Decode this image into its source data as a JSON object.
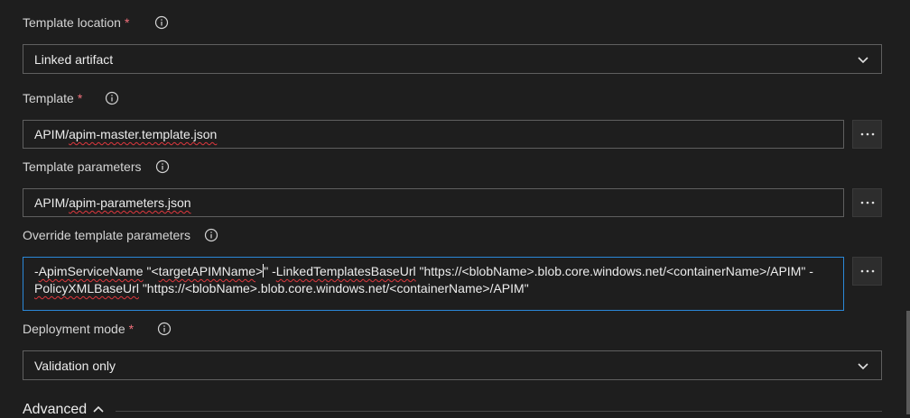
{
  "template_location": {
    "label": "Template location",
    "required": "*",
    "info_icon": "info-circle-icon",
    "value": "Linked artifact",
    "chevron_icon": "chevron-down-icon"
  },
  "template": {
    "label": "Template",
    "required": "*",
    "info_icon": "info-circle-icon",
    "value_prefix": "APIM/",
    "value_squiggle": "apim-master.template.json",
    "more_icon": "ellipsis-icon"
  },
  "template_parameters": {
    "label": "Template parameters",
    "info_icon": "info-circle-icon",
    "value_prefix": "APIM/",
    "value_squiggle": "apim-parameters.json",
    "more_icon": "ellipsis-icon"
  },
  "override_parameters": {
    "label": "Override template parameters",
    "info_icon": "info-circle-icon",
    "line1_a": "-",
    "line1_b": "ApimServiceName",
    "line1_c": " \"<",
    "line1_d": "targetAPIMName",
    "line1_e": ">",
    "line1_f": "\" -",
    "line1_g": "LinkedTemplatesBaseUrl",
    "line1_h": " \"https://<blobName>.blob.core.windows.net/<containerName>/APIM\" -",
    "line2_a": "PolicyXMLBaseUrl",
    "line2_b": " \"https://<blobName>.blob.core.windows.net/<containerName>/APIM\"",
    "more_icon": "ellipsis-icon"
  },
  "deployment_mode": {
    "label": "Deployment mode",
    "required": "*",
    "info_icon": "info-circle-icon",
    "value": "Validation only",
    "chevron_icon": "chevron-down-icon"
  },
  "advanced": {
    "label": "Advanced",
    "chevron_icon": "chevron-up-icon"
  },
  "colors": {
    "background": "#1e1e1e",
    "required": "#f1707b",
    "focus_border": "#2b88d8",
    "spell_error": "#e0383e"
  }
}
